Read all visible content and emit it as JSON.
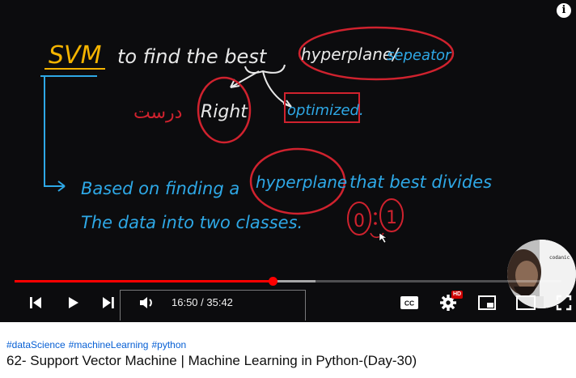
{
  "video": {
    "board": {
      "line1": {
        "svm": "SVM",
        "rest": "to find  the  best"
      },
      "hyperplane_label": "hyperplane/",
      "separator_label": "sepeator",
      "right_label": "Right",
      "urdu_word": "درست",
      "optimized_label": "optimized.",
      "line2": {
        "based": "Based  on  finding  a",
        "hyper": "hyperplane",
        "rest": "that  best  divides"
      },
      "line3": {
        "text": "The  data  into  two  classes.",
        "zero": "0",
        "one": "1"
      }
    },
    "webcam": {
      "shirt_text": "codanic"
    },
    "progress": {
      "played_fraction": 0.4725,
      "buffered_fraction": 0.55
    },
    "time": {
      "current": "16:50",
      "total": "35:42",
      "display": "16:50 / 35:42"
    },
    "controls": {
      "cc_label": "CC",
      "hd_badge": "HD"
    },
    "colors": {
      "accent": "#ff0000",
      "chalk_yellow": "#f5b400",
      "chalk_blue": "#2ea8e6",
      "chalk_red": "#d0222e",
      "chalk_white": "#e8e8e8"
    },
    "icons": [
      "info-icon",
      "previous-icon",
      "play-icon",
      "next-icon",
      "volume-icon",
      "cc-icon",
      "settings-icon",
      "miniplayer-icon",
      "theater-icon",
      "fullscreen-icon"
    ]
  },
  "below": {
    "hashtags": [
      "#dataScience",
      "#machineLearning",
      "#python"
    ],
    "title": "62- Support Vector Machine | Machine Learning in Python-(Day-30)"
  }
}
